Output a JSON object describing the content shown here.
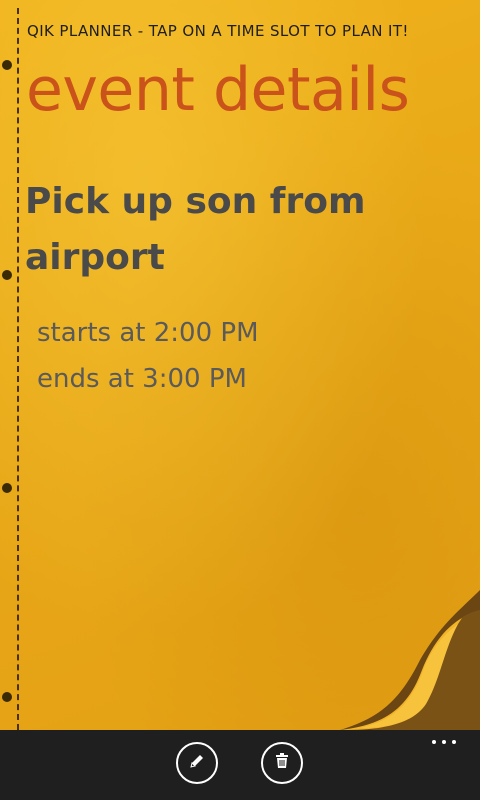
{
  "app": {
    "title": "QIK PLANNER - TAP ON A TIME SLOT TO PLAN IT!"
  },
  "page": {
    "title": "event details"
  },
  "event": {
    "title": "Pick up son from airport",
    "starts": "starts at 2:00 PM",
    "ends": "ends at 3:00 PM"
  },
  "appbar": {
    "buttons": [
      {
        "icon": "pencil-icon"
      },
      {
        "icon": "trash-icon"
      }
    ],
    "more_icon": "ellipsis-icon"
  },
  "colors": {
    "paper": "#e8a817",
    "title_accent": "#c9531a",
    "text": "#4a4a4a",
    "appbar": "#1f1f1f"
  }
}
